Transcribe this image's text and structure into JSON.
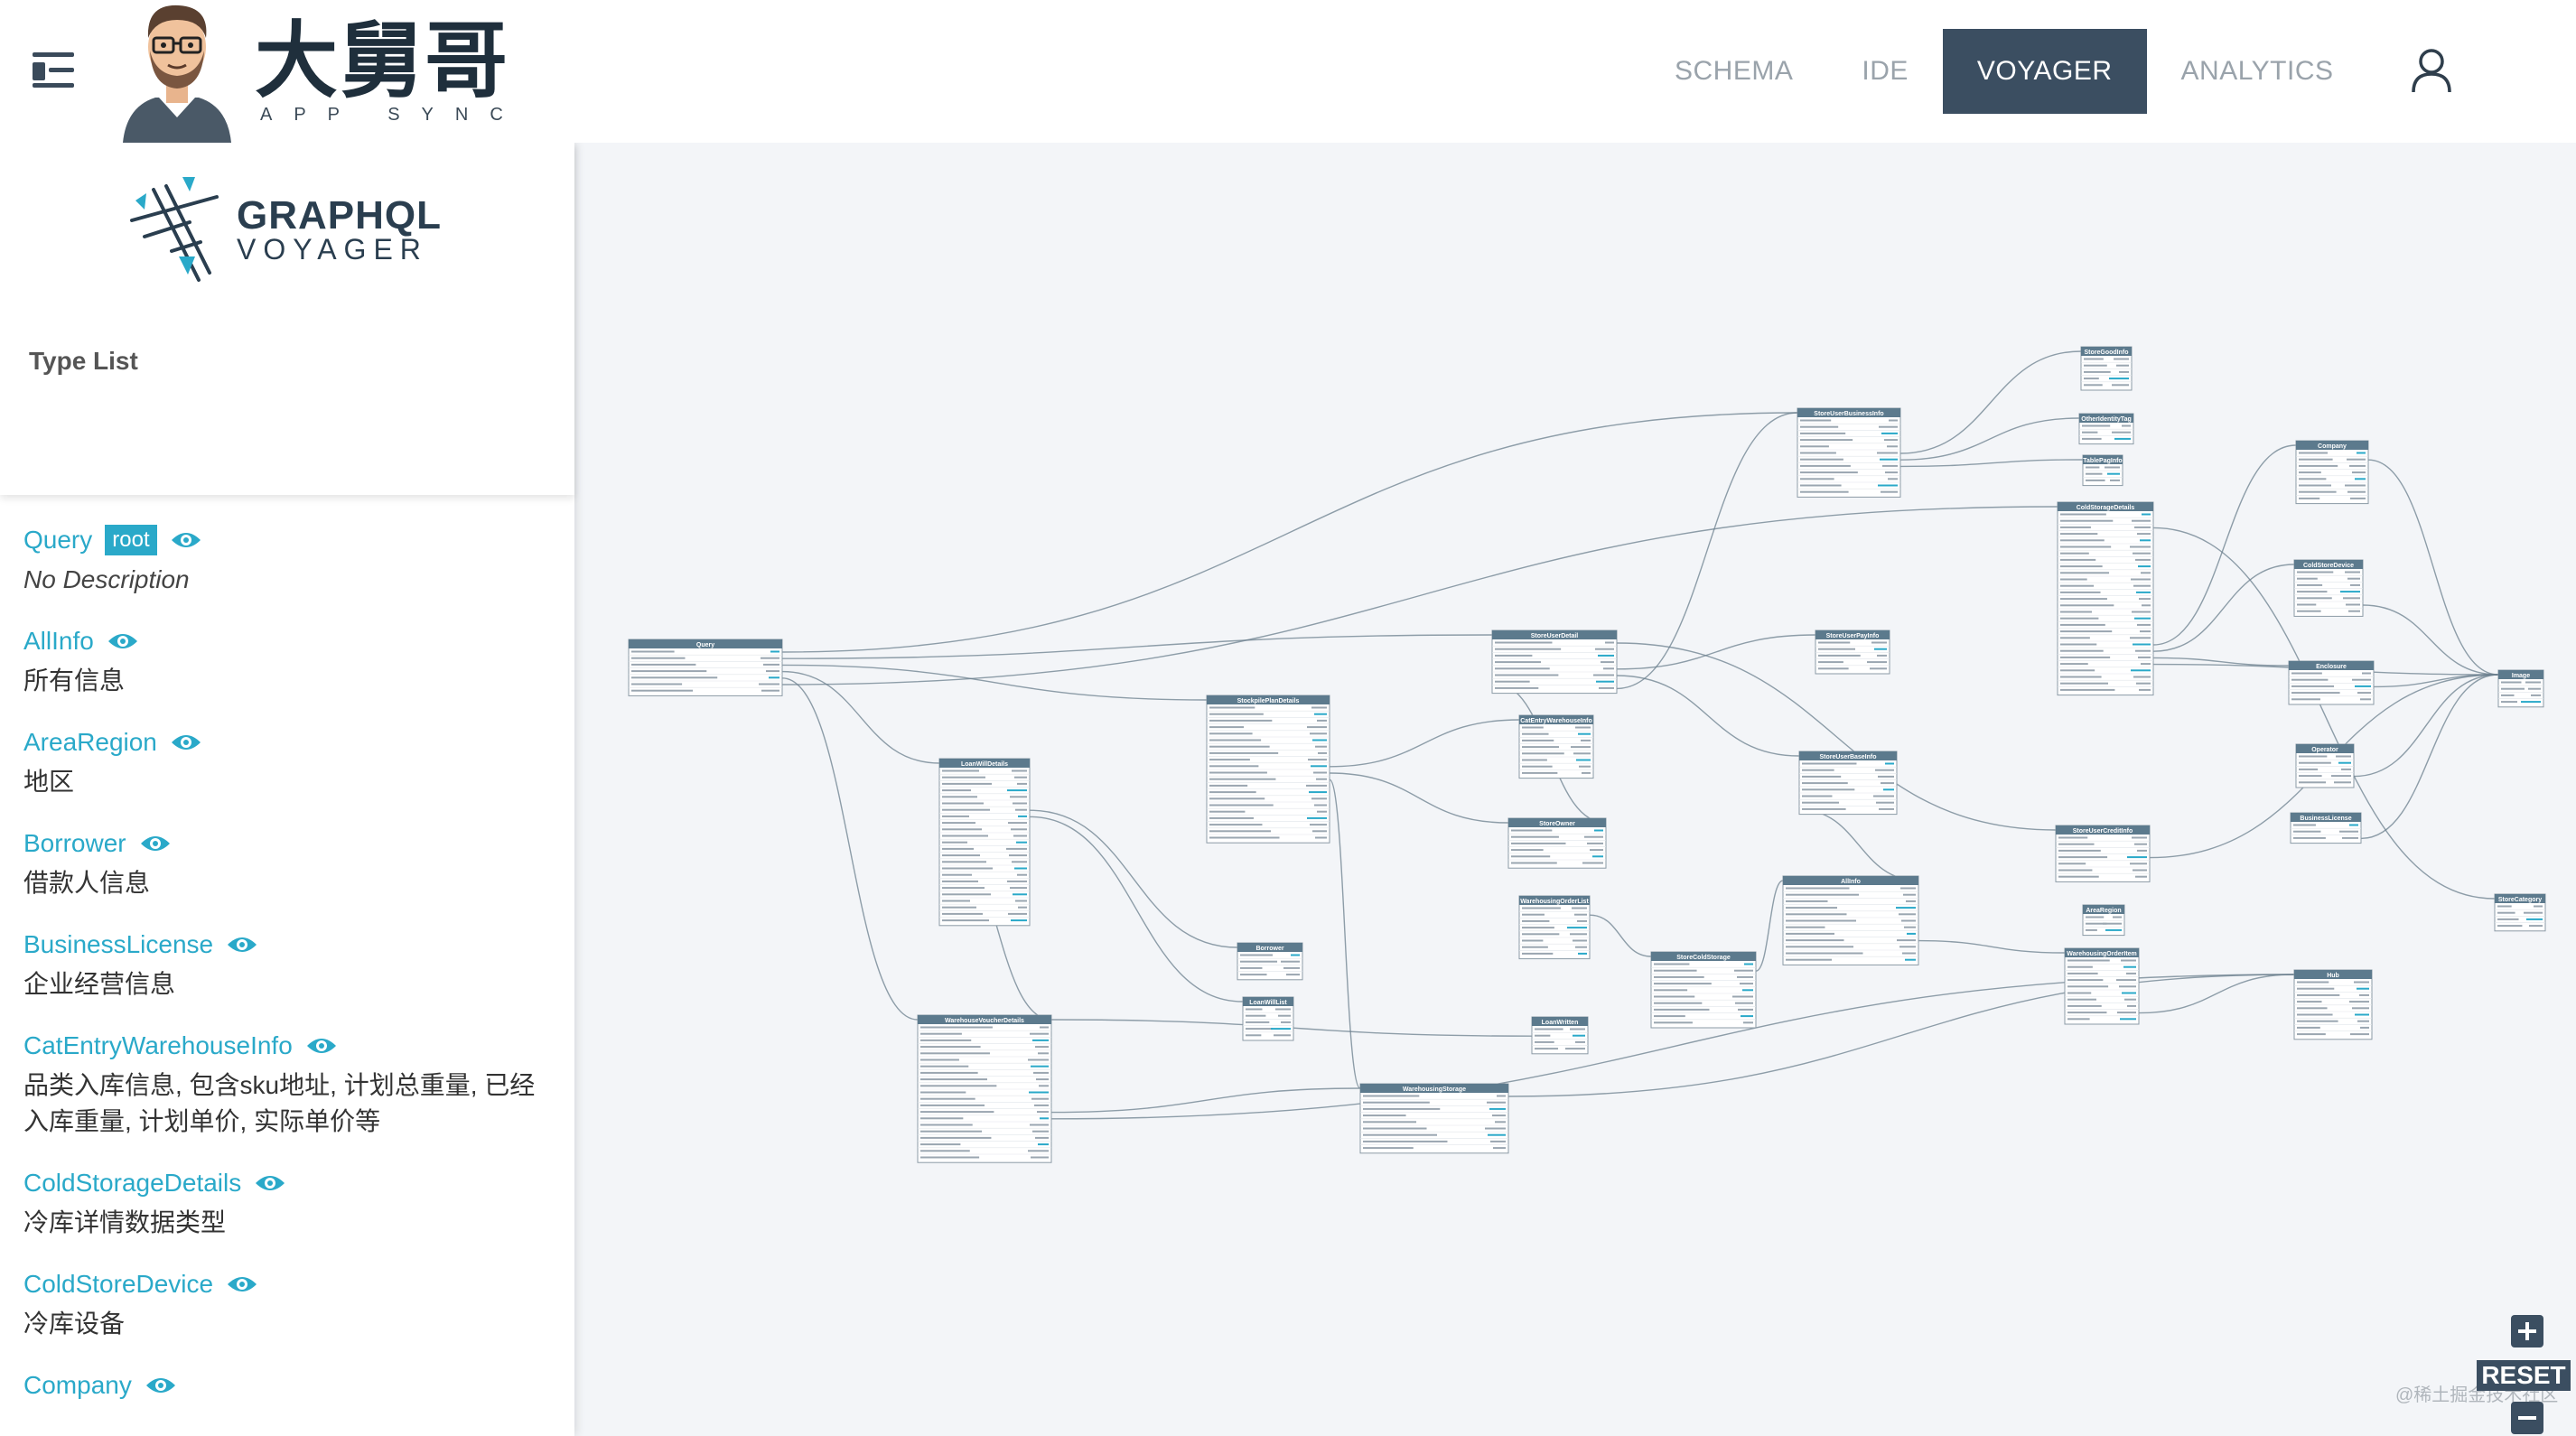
{
  "header": {
    "brand_title": "大舅哥",
    "brand_subtitle": "APP SYNC",
    "tabs": [
      {
        "label": "SCHEMA",
        "active": false
      },
      {
        "label": "IDE",
        "active": false
      },
      {
        "label": "VOYAGER",
        "active": true
      },
      {
        "label": "ANALYTICS",
        "active": false
      }
    ],
    "icons": {
      "menu": "menu-collapse-icon",
      "user": "user-icon"
    }
  },
  "sidebar": {
    "logo_top": "GRAPHQL",
    "logo_bottom": "VOYAGER",
    "type_list_title": "Type List",
    "items": [
      {
        "name": "Query",
        "badge": "root",
        "desc": "No Description"
      },
      {
        "name": "AllInfo",
        "desc": "所有信息"
      },
      {
        "name": "AreaRegion",
        "desc": "地区"
      },
      {
        "name": "Borrower",
        "desc": "借款人信息"
      },
      {
        "name": "BusinessLicense",
        "desc": "企业经营信息"
      },
      {
        "name": "CatEntryWarehouseInfo",
        "desc": "品类入库信息, 包含sku地址, 计划总重量, 已经入库重量, 计划单价, 实际单价等"
      },
      {
        "name": "ColdStorageDetails",
        "desc": "冷库详情数据类型"
      },
      {
        "name": "ColdStoreDevice",
        "desc": "冷库设备"
      },
      {
        "name": "Company",
        "desc": ""
      }
    ]
  },
  "graph": {
    "nodes": [
      {
        "title": "Query",
        "rows": 7
      },
      {
        "title": "LoanWillDetails",
        "rows": 24
      },
      {
        "title": "WarehouseVoucherDetails",
        "rows": 21
      },
      {
        "title": "StockpilePlanDetails",
        "rows": 21
      },
      {
        "title": "Borrower",
        "rows": 4
      },
      {
        "title": "LoanWillList",
        "rows": 5
      },
      {
        "title": "StoreUserDetail",
        "rows": 8
      },
      {
        "title": "CatEntryWarehouseInfo",
        "rows": 8
      },
      {
        "title": "StoreOwner",
        "rows": 6
      },
      {
        "title": "WarehousingOrderList",
        "rows": 8
      },
      {
        "title": "WarehousingStorage",
        "rows": 9
      },
      {
        "title": "LoanWritten",
        "rows": 4
      },
      {
        "title": "StoreColdStorage",
        "rows": 10
      },
      {
        "title": "AllInfo",
        "rows": 12
      },
      {
        "title": "StoreUserBusinessInfo",
        "rows": 12
      },
      {
        "title": "StoreUserPayInfo",
        "rows": 5
      },
      {
        "title": "StoreUserBaseInfo",
        "rows": 8
      },
      {
        "title": "StoreGoodInfo",
        "rows": 5
      },
      {
        "title": "OtherIdentityTag",
        "rows": 3
      },
      {
        "title": "TablePagInfo",
        "rows": 3
      },
      {
        "title": "ColdStorageDetails",
        "rows": 28
      },
      {
        "title": "StoreUserCreditInfo",
        "rows": 7
      },
      {
        "title": "AreaRegion",
        "rows": 3
      },
      {
        "title": "WarehousingOrderItem",
        "rows": 10
      },
      {
        "title": "Company",
        "rows": 8
      },
      {
        "title": "ColdStoreDevice",
        "rows": 7
      },
      {
        "title": "Enclosure",
        "rows": 5
      },
      {
        "title": "Operator",
        "rows": 5
      },
      {
        "title": "BusinessLicense",
        "rows": 3
      },
      {
        "title": "Image",
        "rows": 4
      },
      {
        "title": "StoreCategory",
        "rows": 4
      },
      {
        "title": "Hub",
        "rows": 9
      }
    ]
  },
  "controls": {
    "reset_label": "RESET",
    "zoom_in": "zoom-in-icon",
    "zoom_out": "zoom-out-icon"
  },
  "watermark": "@稀土掘金技术社区",
  "colors": {
    "accent": "#2aa9c9",
    "dark": "#3b4e61",
    "canvas_bg": "#f3f5f8",
    "node_header": "#5c7a8d"
  }
}
